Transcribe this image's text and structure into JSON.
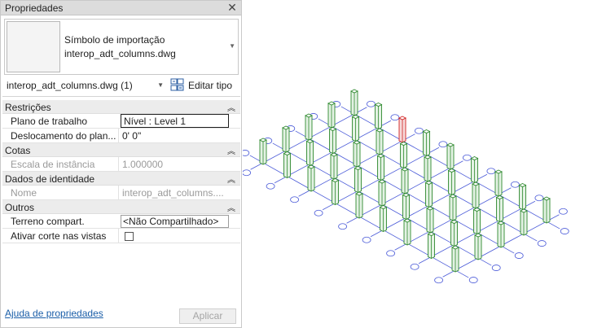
{
  "panel": {
    "title": "Propriedades",
    "close_glyph": "✕",
    "type_preview": {
      "line1": "Símbolo de importação",
      "line2": "interop_adt_columns.dwg"
    },
    "type_selector": {
      "value": "interop_adt_columns.dwg (1)"
    },
    "edit_type_label": "Editar tipo",
    "sections": {
      "restricoes": {
        "label": "Restrições",
        "plano_label": "Plano de trabalho",
        "plano_value": "Nível : Level 1",
        "desloc_label": "Deslocamento do plan...",
        "desloc_value": "0'  0\""
      },
      "cotas": {
        "label": "Cotas",
        "escala_label": "Escala de instância",
        "escala_value": "1.000000"
      },
      "identidade": {
        "label": "Dados de identidade",
        "nome_label": "Nome",
        "nome_value": "interop_adt_columns...."
      },
      "outros": {
        "label": "Outros",
        "terreno_label": "Terreno compart.",
        "terreno_value": "<Não Compartilhado>",
        "corte_label": "Ativar corte nas vistas"
      }
    },
    "collapse_glyph": "⌃",
    "help_link": "Ajuda de propriedades",
    "apply_button": "Aplicar"
  },
  "viewport": {
    "grid_color": "#4a5ad8",
    "column_color": "#2f8a2f",
    "selected_color": "#d02020",
    "bubble_color": "#4a5ad8"
  }
}
